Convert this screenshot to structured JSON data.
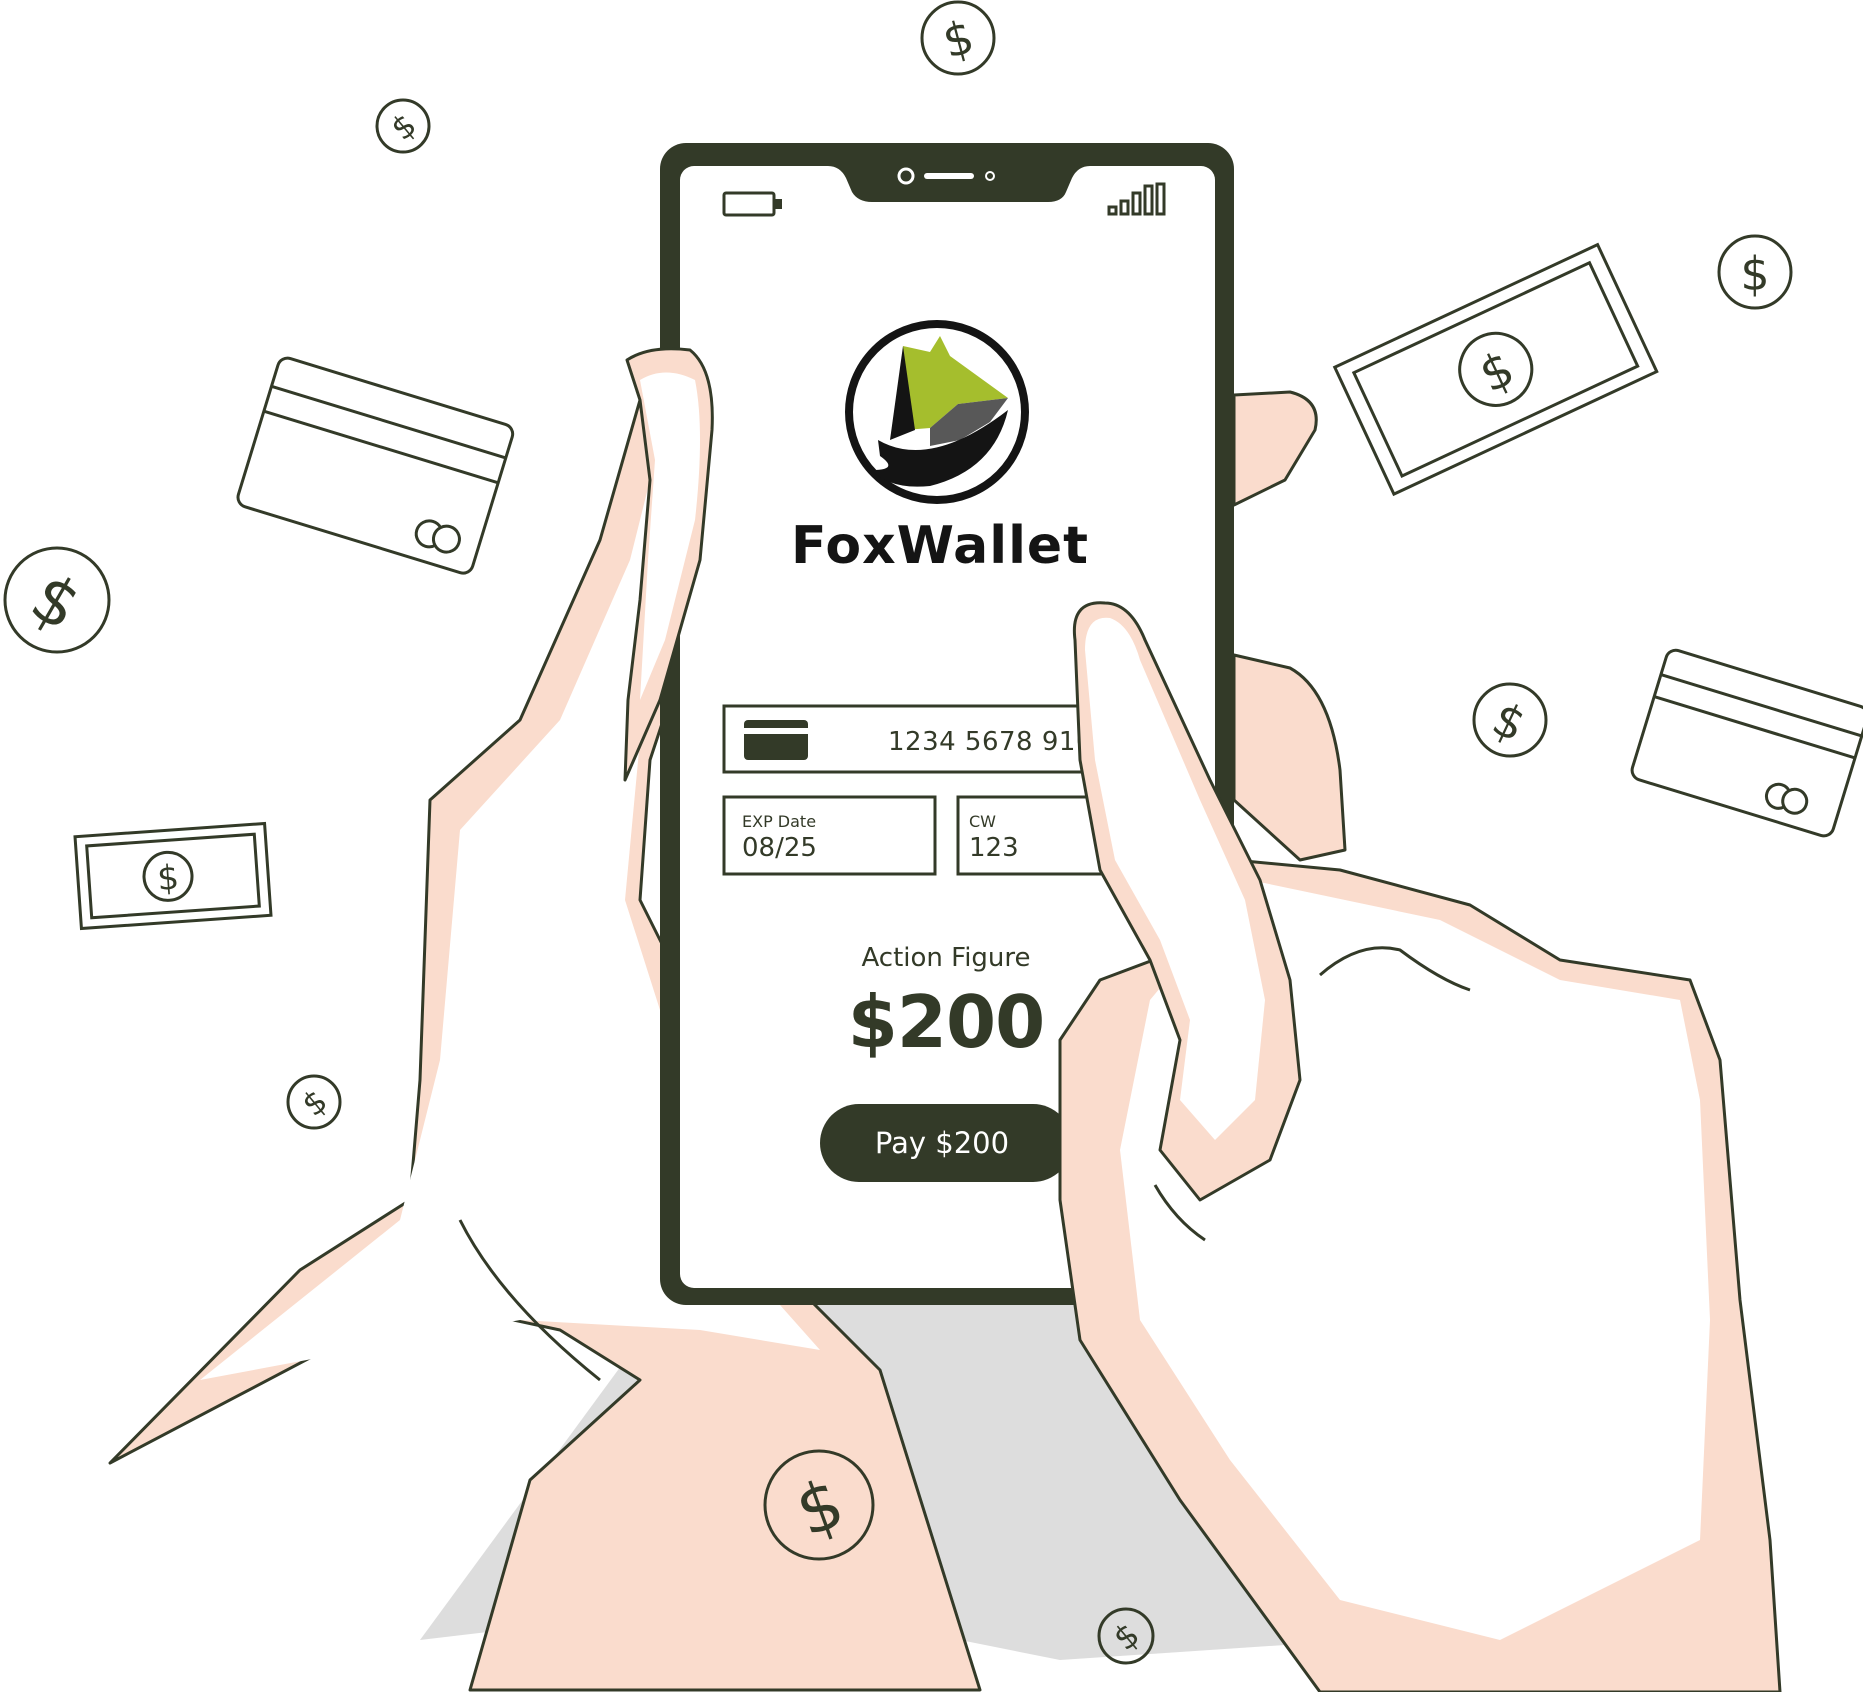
{
  "app": {
    "name": "FoxWallet"
  },
  "payment_form": {
    "card_number": "1234 5678 910",
    "expiry_label": "EXP Date",
    "expiry_value": "08/25",
    "cvv_label": "CW",
    "cvv_value": "123"
  },
  "product": {
    "name": "Action Figure",
    "price": "$200"
  },
  "pay_button": {
    "label": "Pay $200"
  },
  "colors": {
    "ink": "#333a28",
    "skin": "#fadccd",
    "logo_green": "#a5be2d",
    "shadow": "#d9d9d9"
  },
  "icons": [
    "battery-icon",
    "signal-bars-icon",
    "fox-logo-icon",
    "credit-card-icon",
    "dollar-coin-icon",
    "banknote-icon"
  ]
}
